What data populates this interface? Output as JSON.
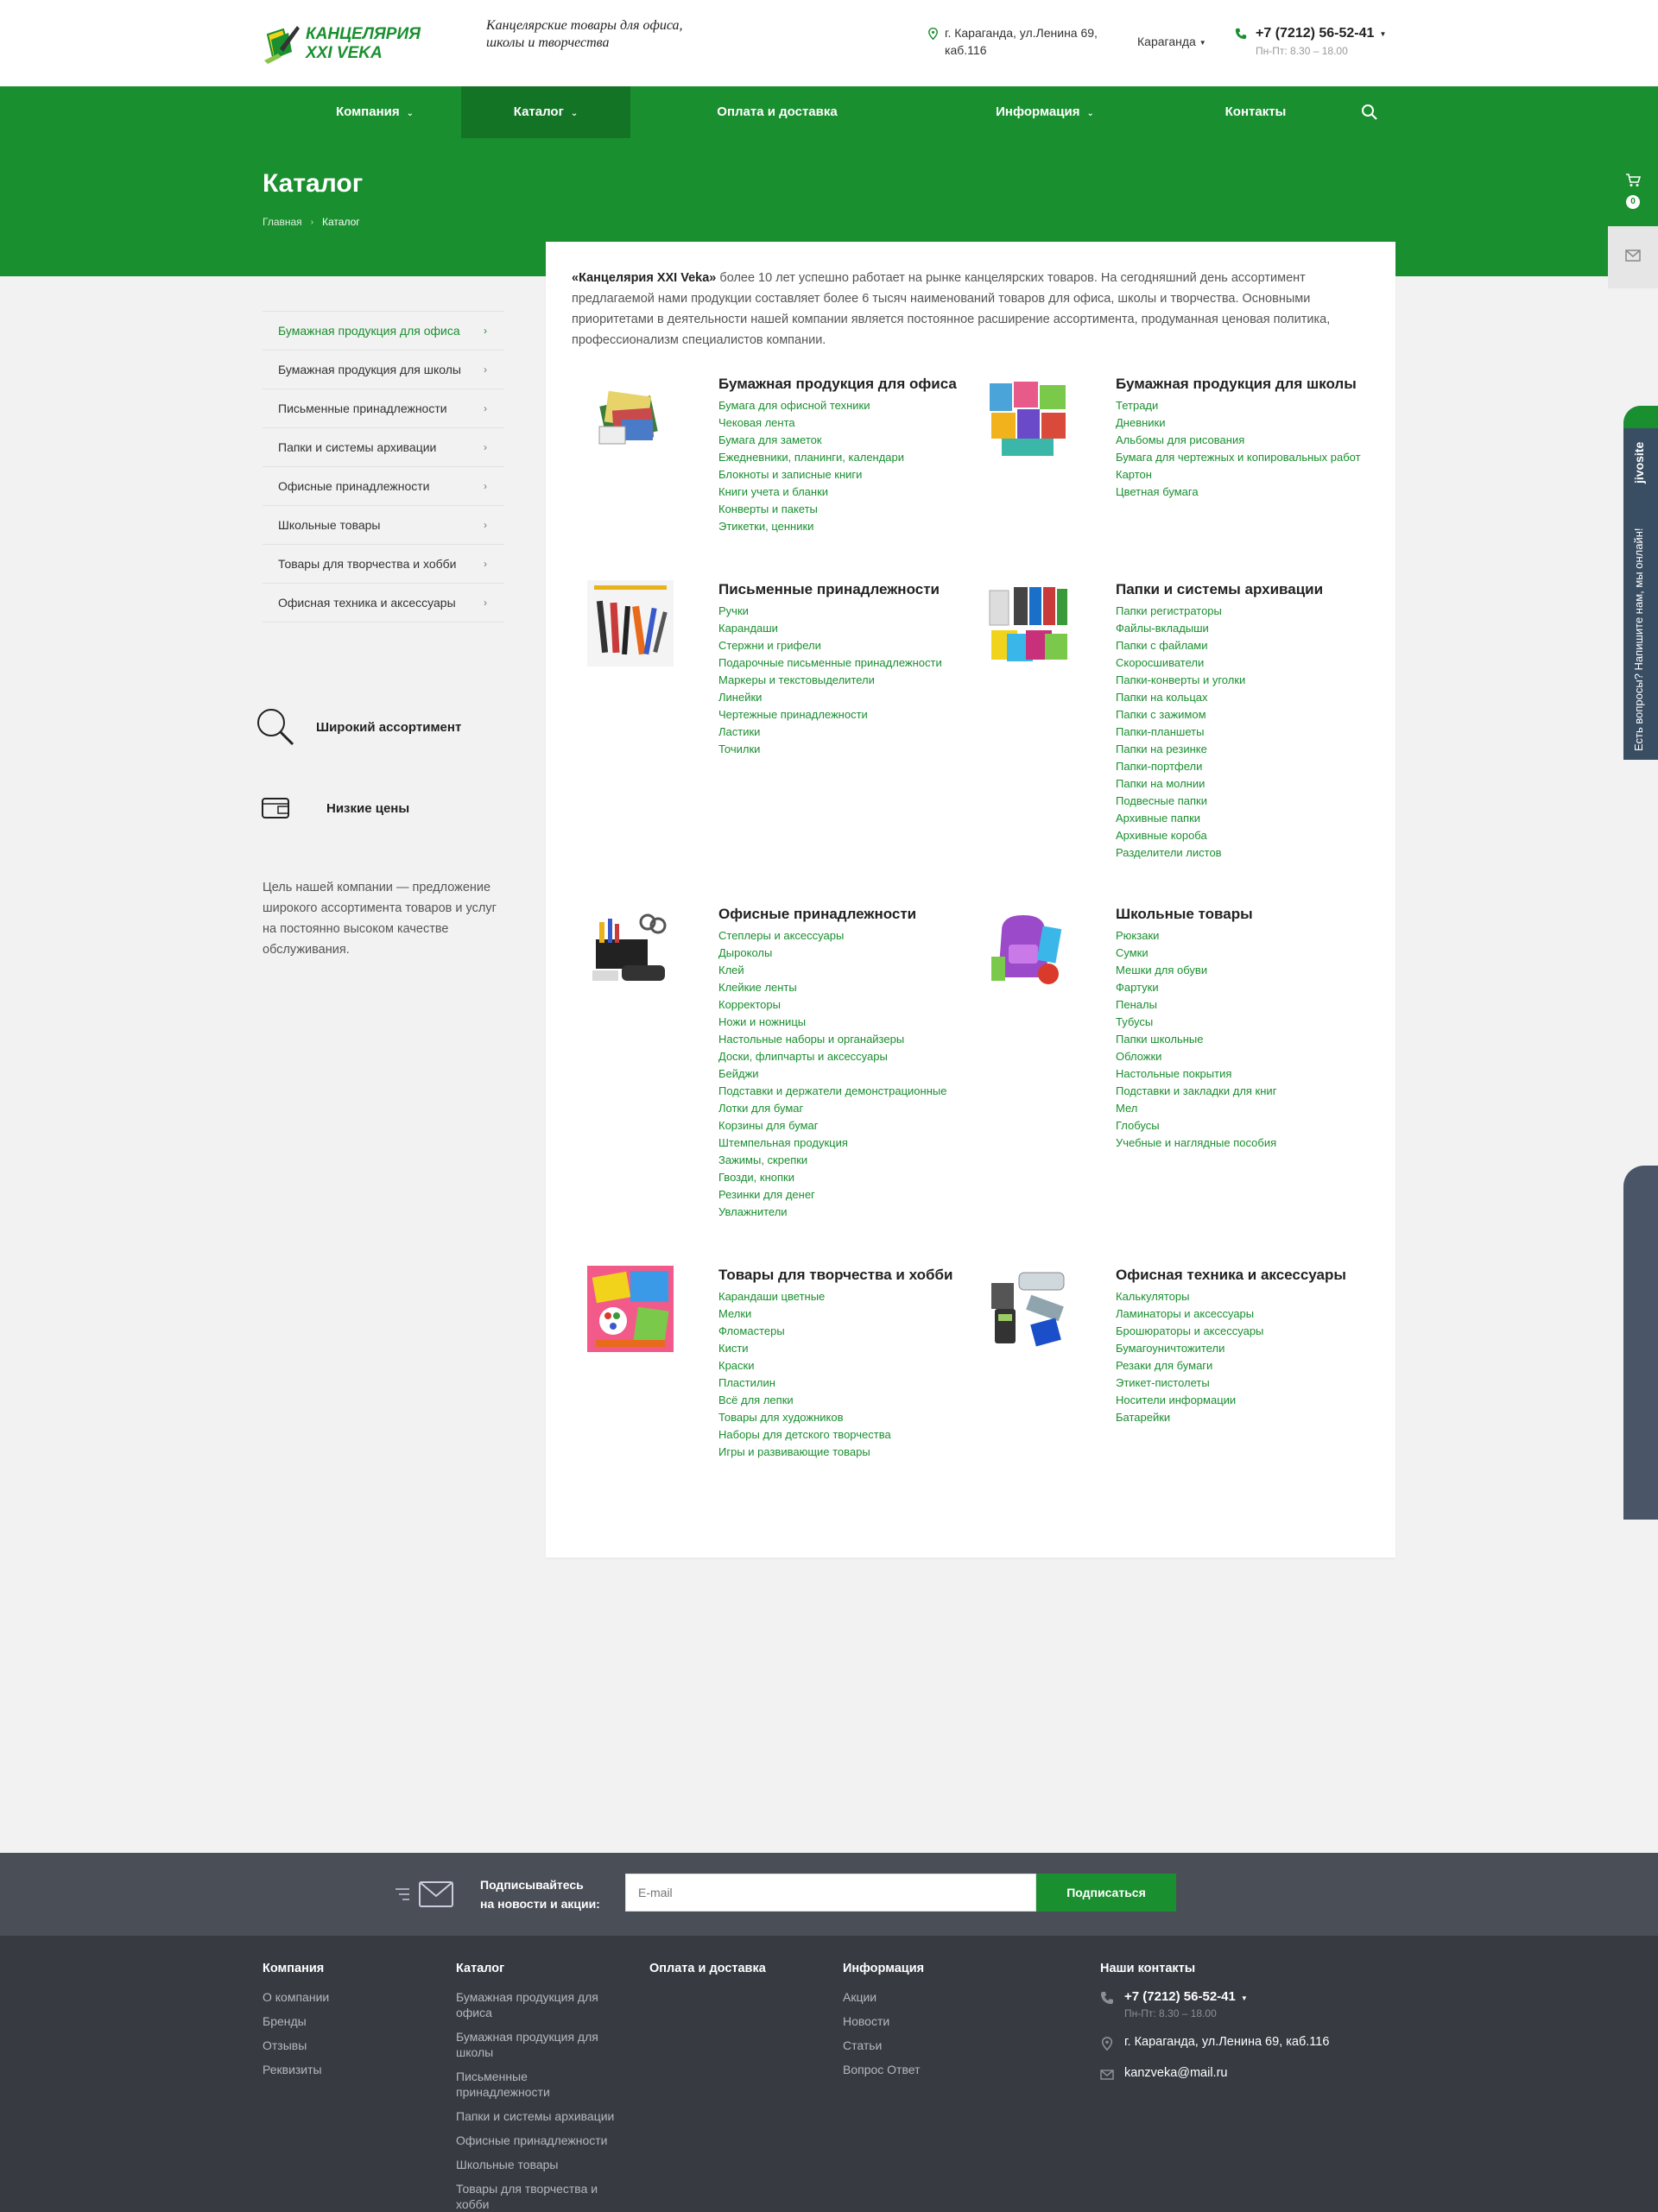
{
  "header": {
    "logo_line1": "КАНЦЕЛЯРИЯ",
    "logo_line2": "XXI VEKA",
    "slogan": "Канцелярские товары для офиса, школы и творчества",
    "address": "г. Караганда, ул.Ленина 69, каб.116",
    "city": "Караганда",
    "phone": "+7 (7212) 56-52-41",
    "hours": "Пн-Пт: 8.30 – 18.00"
  },
  "nav": {
    "items": [
      {
        "label": "Компания"
      },
      {
        "label": "Каталог"
      },
      {
        "label": "Оплата и доставка"
      },
      {
        "label": "Информация"
      },
      {
        "label": "Контакты"
      }
    ]
  },
  "hero": {
    "title": "Каталог",
    "breadcrumb_home": "Главная",
    "breadcrumb_current": "Каталог"
  },
  "cart": {
    "count": "0"
  },
  "jivo": {
    "brand": "jivosite",
    "text": "Есть вопросы? Напишите нам, мы онлайн!"
  },
  "sidebar": {
    "items": [
      {
        "label": "Бумажная продукция для офиса"
      },
      {
        "label": "Бумажная продукция для школы"
      },
      {
        "label": "Письменные принадлежности"
      },
      {
        "label": "Папки и системы архивации"
      },
      {
        "label": "Офисные принадлежности"
      },
      {
        "label": "Школьные товары"
      },
      {
        "label": "Товары для творчества и хобби"
      },
      {
        "label": "Офисная техника и аксессуары"
      }
    ],
    "advantages": [
      {
        "label": "Широкий ассортимент"
      },
      {
        "label": "Низкие цены"
      }
    ],
    "mission": "Цель нашей компании — предложение широкого ассортимента товаров и услуг на постоянно высоком качестве обслуживания."
  },
  "intro": {
    "brand": "«Канцелярия XXI Veka»",
    "text": " более 10 лет успешно работает на рынке канцелярских товаров. На сегодняшний день ассортимент предлагаемой нами продукции составляет более 6 тысяч наименований товаров для офиса, школы и творчества. Основными приоритетами в деятельности нашей компании является постоянное расширение ассортимента, продуманная ценовая политика, профессионализм специалистов компании."
  },
  "categories": [
    {
      "title": "Бумажная продукция для офиса",
      "links": [
        "Бумага для офисной техники",
        "Чековая лента",
        "Бумага для заметок",
        "Ежедневники, планинги, календари",
        "Блокноты и записные книги",
        "Книги учета и бланки",
        "Конверты и пакеты",
        "Этикетки, ценники"
      ]
    },
    {
      "title": "Бумажная продукция для школы",
      "links": [
        "Тетради",
        "Дневники",
        "Альбомы для рисования",
        "Бумага для чертежных и копировальных работ",
        "Картон",
        "Цветная бумага"
      ]
    },
    {
      "title": "Письменные принадлежности",
      "links": [
        "Ручки",
        "Карандаши",
        "Стержни и грифели",
        "Подарочные письменные принадлежности",
        "Маркеры и текстовыделители",
        "Линейки",
        "Чертежные принадлежности",
        "Ластики",
        "Точилки"
      ]
    },
    {
      "title": "Папки и системы архивации",
      "links": [
        "Папки регистраторы",
        "Файлы-вкладыши",
        "Папки с файлами",
        "Скоросшиватели",
        "Папки-конверты и уголки",
        "Папки на кольцах",
        "Папки с зажимом",
        "Папки-планшеты",
        "Папки на резинке",
        "Папки-портфели",
        "Папки на молнии",
        "Подвесные папки",
        "Архивные папки",
        "Архивные короба",
        "Разделители листов"
      ]
    },
    {
      "title": "Офисные принадлежности",
      "links": [
        "Степлеры и аксессуары",
        "Дыроколы",
        "Клей",
        "Клейкие ленты",
        "Корректоры",
        "Ножи и ножницы",
        "Настольные наборы и органайзеры",
        "Доски, флипчарты и аксессуары",
        "Бейджи",
        "Подставки и держатели демонстрационные",
        "Лотки для бумаг",
        "Корзины для бумаг",
        "Штемпельная продукция",
        "Зажимы, скрепки",
        "Гвозди, кнопки",
        "Резинки для денег",
        "Увлажнители"
      ]
    },
    {
      "title": "Школьные товары",
      "links": [
        "Рюкзаки",
        "Сумки",
        "Мешки для обуви",
        "Фартуки",
        "Пеналы",
        "Тубусы",
        "Папки школьные",
        "Обложки",
        "Настольные покрытия",
        "Подставки и закладки для книг",
        "Мел",
        "Глобусы",
        "Учебные и наглядные пособия"
      ]
    },
    {
      "title": "Товары для творчества и хобби",
      "links": [
        "Карандаши цветные",
        "Мелки",
        "Фломастеры",
        "Кисти",
        "Краски",
        "Пластилин",
        "Всё для лепки",
        "Товары для художников",
        "Наборы для детского творчества",
        "Игры и развивающие товары"
      ]
    },
    {
      "title": "Офисная техника и аксессуары",
      "links": [
        "Калькуляторы",
        "Ламинаторы и аксессуары",
        "Брошюраторы и аксессуары",
        "Бумагоуничтожители",
        "Резаки для бумаги",
        "Этикет-пистолеты",
        "Носители информации",
        "Батарейки"
      ]
    }
  ],
  "subscribe": {
    "text_line1": "Подписывайтесь",
    "text_line2": "на новости и акции:",
    "placeholder": "E-mail",
    "button": "Подписаться"
  },
  "footer": {
    "company": {
      "title": "Компания",
      "links": [
        "О компании",
        "Бренды",
        "Отзывы",
        "Реквизиты"
      ]
    },
    "catalog": {
      "title": "Каталог",
      "links": [
        "Бумажная продукция для офиса",
        "Бумажная продукция для школы",
        "Письменные принадлежности",
        "Папки и системы архивации",
        "Офисные принадлежности",
        "Школьные товары",
        "Товары для творчества и хобби"
      ]
    },
    "delivery": {
      "title": "Оплата и доставка"
    },
    "info": {
      "title": "Информация",
      "links": [
        "Акции",
        "Новости",
        "Статьи",
        "Вопрос Ответ"
      ]
    },
    "contacts": {
      "title": "Наши контакты",
      "phone": "+7 (7212) 56-52-41",
      "hours": "Пн-Пт: 8.30 – 18.00",
      "address": "г. Караганда, ул.Ленина 69, каб.116",
      "email": "kanzveka@mail.ru"
    }
  },
  "colors": {
    "brand_green": "#1a8f2f",
    "dark_green": "#147426",
    "footer_dark": "#373a41"
  }
}
